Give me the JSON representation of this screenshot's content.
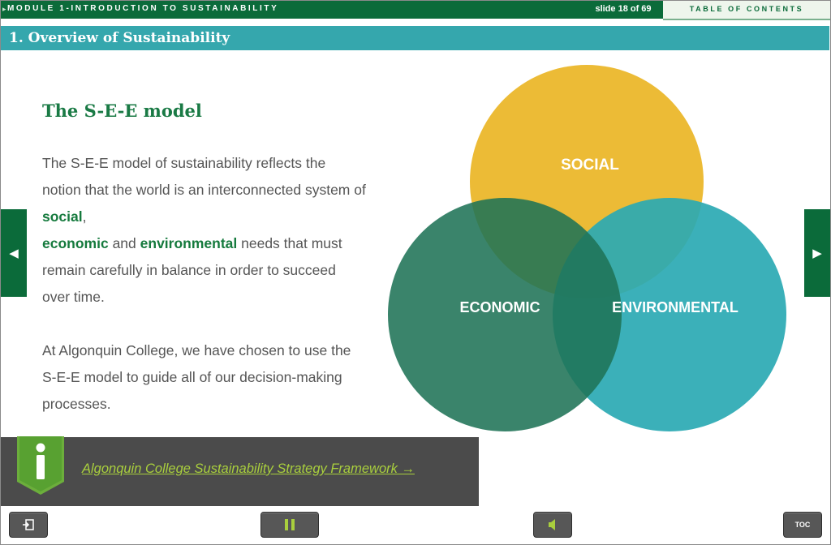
{
  "header": {
    "module_title": "MODULE 1-INTRODUCTION TO SUSTAINABILITY",
    "slide_counter": "slide 18 of 69",
    "toc_tab": "TABLE OF CONTENTS"
  },
  "section": {
    "title": "1. Overview of Sustainability"
  },
  "content": {
    "heading": "The S-E-E model",
    "para1": {
      "part1": "The S-E-E model of sustainability reflects the notion that the world is an interconnected system of ",
      "social": "social",
      "comma": ",",
      "economic": "economic",
      "and": " and ",
      "environmental": "environmental",
      "part2": " needs that must remain carefully in balance in order to succeed over time."
    },
    "para2": "At Algonquin College, we have chosen to use the S-E-E model to guide all of our decision-making processes."
  },
  "venn": {
    "social": "SOCIAL",
    "economic": "ECONOMIC",
    "environmental": "ENVIRONMENTAL",
    "colors": {
      "social": "#ebb92f",
      "economic": "#26785b",
      "environmental": "#2aa9b3"
    }
  },
  "info": {
    "link_text": "Algonquin College Sustainability Strategy Framework →"
  },
  "nav": {
    "prev_icon": "◀",
    "next_icon": "▶"
  },
  "controls": {
    "toc_label": "TOC"
  }
}
